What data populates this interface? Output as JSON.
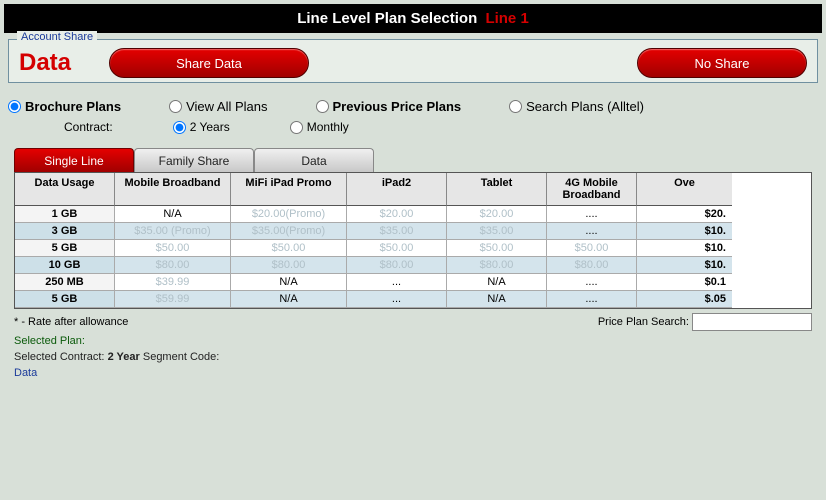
{
  "title": {
    "main": "Line Level Plan Selection",
    "line": "Line 1"
  },
  "panel": {
    "legend": "Account Share",
    "data_label": "Data",
    "share_btn": "Share Data",
    "noshare_btn": "No Share"
  },
  "filters": {
    "brochure": "Brochure Plans",
    "viewall": "View All Plans",
    "previous": "Previous Price Plans",
    "search": "Search Plans (Alltel)",
    "contract_label": "Contract:",
    "two_year": "2 Years",
    "monthly": "Monthly"
  },
  "tabs": {
    "single": "Single Line",
    "family": "Family Share",
    "data": "Data"
  },
  "headers": {
    "usage": "Data Usage",
    "mbb": "Mobile Broadband",
    "mifi": "MiFi iPad Promo",
    "ipad2": "iPad2",
    "tablet": "Tablet",
    "g4": "4G Mobile Broadband",
    "over": "Ove"
  },
  "rows": [
    {
      "usage": "1 GB",
      "mbb": "N/A",
      "mifi": "$20.00(Promo)",
      "ipad2": "$20.00",
      "tablet": "$20.00",
      "g4": "....",
      "over": "$20."
    },
    {
      "usage": "3 GB",
      "mbb": "$35.00 (Promo)",
      "mifi": "$35.00(Promo)",
      "ipad2": "$35.00",
      "tablet": "$35.00",
      "g4": "....",
      "over": "$10."
    },
    {
      "usage": "5 GB",
      "mbb": "$50.00",
      "mifi": "$50.00",
      "ipad2": "$50.00",
      "tablet": "$50.00",
      "g4": "$50.00",
      "over": "$10."
    },
    {
      "usage": "10 GB",
      "mbb": "$80.00",
      "mifi": "$80.00",
      "ipad2": "$80.00",
      "tablet": "$80.00",
      "g4": "$80.00",
      "over": "$10."
    },
    {
      "usage": "250 MB",
      "mbb": "$39.99",
      "mifi": "N/A",
      "ipad2": "...",
      "tablet": "N/A",
      "g4": "....",
      "over": "$0.1"
    },
    {
      "usage": "5 GB",
      "mbb": "$59.99",
      "mifi": "N/A",
      "ipad2": "...",
      "tablet": "N/A",
      "g4": "....",
      "over": "$.05"
    }
  ],
  "footnote": "* - Rate after allowance",
  "search_label": "Price Plan Search:",
  "selected": {
    "plan_label": "Selected Plan:",
    "contract_label": "Selected Contract:",
    "contract_value": "2 Year",
    "segment_label": "Segment Code:",
    "data_link": "Data"
  }
}
